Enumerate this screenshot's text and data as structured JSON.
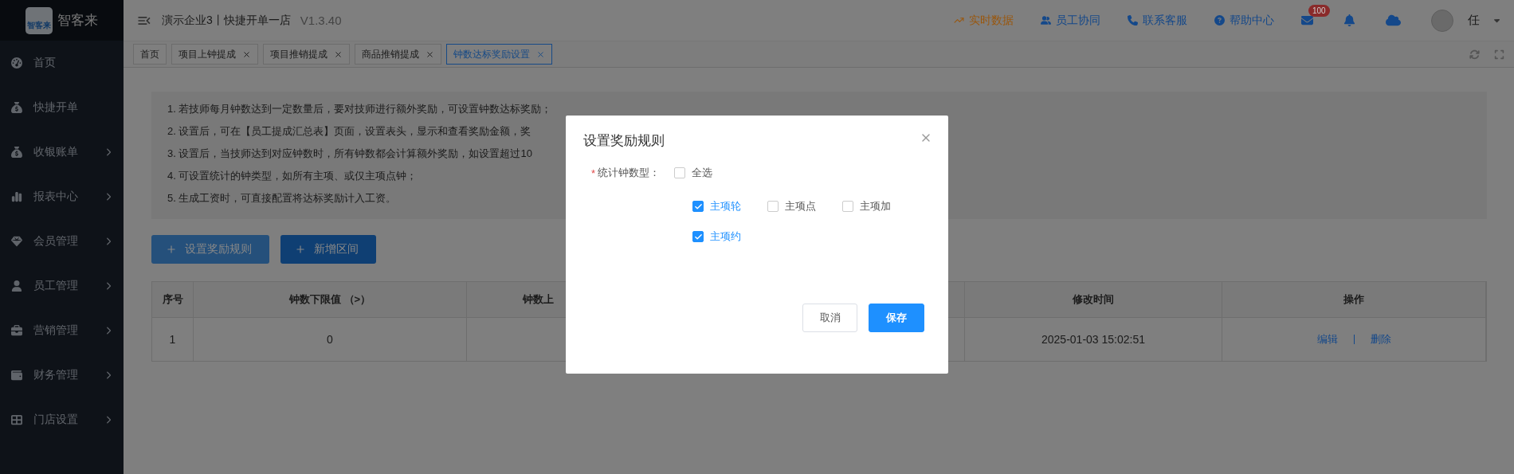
{
  "brand": {
    "name": "智客来",
    "logo_text": "智客来"
  },
  "sidebar": {
    "items": [
      {
        "label": "首页",
        "has_children": false
      },
      {
        "label": "快捷开单",
        "has_children": false
      },
      {
        "label": "收银账单",
        "has_children": true
      },
      {
        "label": "报表中心",
        "has_children": true
      },
      {
        "label": "会员管理",
        "has_children": true
      },
      {
        "label": "员工管理",
        "has_children": true
      },
      {
        "label": "营销管理",
        "has_children": true
      },
      {
        "label": "财务管理",
        "has_children": true
      },
      {
        "label": "门店设置",
        "has_children": true
      }
    ]
  },
  "header": {
    "store": "演示企业3丨快捷开单一店",
    "version": "V1.3.40",
    "links": [
      {
        "label": "实时数据",
        "color": "#9a570d"
      },
      {
        "label": "员工协同",
        "color": "#14488a"
      },
      {
        "label": "联系客服",
        "color": "#14488a"
      },
      {
        "label": "帮助中心",
        "color": "#14488a"
      }
    ],
    "mail_badge": "100",
    "user": "任"
  },
  "tabs": [
    {
      "label": "首页",
      "closable": false,
      "selected": false
    },
    {
      "label": "项目上钟提成",
      "closable": true,
      "selected": false
    },
    {
      "label": "项目推销提成",
      "closable": true,
      "selected": false
    },
    {
      "label": "商品推销提成",
      "closable": true,
      "selected": false
    },
    {
      "label": "钟数达标奖励设置",
      "closable": true,
      "selected": true
    }
  ],
  "notes": [
    "1. 若技师每月钟数达到一定数量后，要对技师进行额外奖励，可设置钟数达标奖励；",
    "2. 设置后，可在【员工提成汇总表】页面，设置表头，显示和查看奖励金额，奖",
    "3. 设置后，当技师达到对应钟数时，所有钟数都会计算额外奖励，如设置超过10",
    "4. 可设置统计的钟类型，如所有主项、或仅主项点钟；",
    "5. 生成工资时，可直接配置将达标奖励计入工资。"
  ],
  "actions": [
    "设置奖励规则",
    "新增区间"
  ],
  "table": {
    "columns": [
      "序号",
      "钟数下限值 （>）",
      "钟数上",
      "修改时间",
      "操作"
    ],
    "rows": [
      {
        "index": "1",
        "lower": "0",
        "modified": "2025-01-03 15:02:51",
        "links": [
          "编辑",
          "删除"
        ]
      }
    ]
  },
  "dialog": {
    "title": "设置奖励规则",
    "field_label": "统计钟数型：",
    "required_mark": "*",
    "select_all": {
      "label": "全选",
      "checked": false
    },
    "options": [
      {
        "label": "主项轮",
        "checked": true
      },
      {
        "label": "主项点",
        "checked": false
      },
      {
        "label": "主项加",
        "checked": false
      },
      {
        "label": "主项约",
        "checked": true
      }
    ],
    "buttons": [
      {
        "label": "取消",
        "kind": "default"
      },
      {
        "label": "保存",
        "kind": "primary"
      }
    ]
  }
}
